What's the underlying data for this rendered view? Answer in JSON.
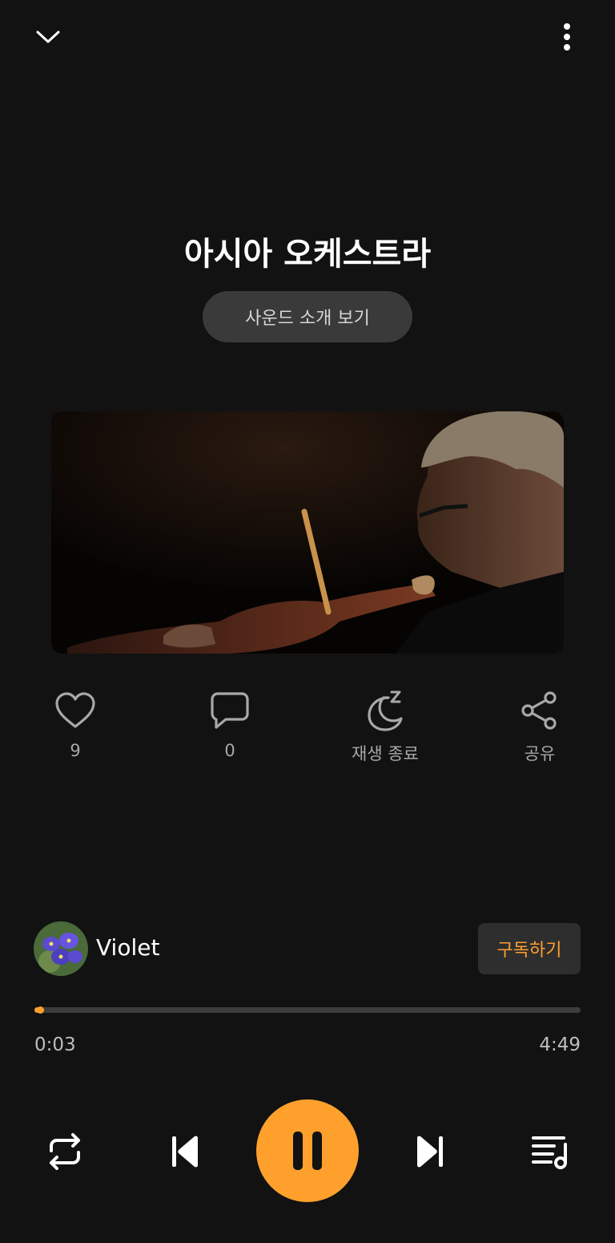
{
  "header": {
    "collapse_icon": "chevron-down-icon",
    "more_icon": "more-vertical-icon"
  },
  "track": {
    "title": "아시아 오케스트라",
    "intro_button_label": "사운드 소개 보기",
    "cover_description": "violinist"
  },
  "actions": [
    {
      "icon": "heart-icon",
      "label": "9"
    },
    {
      "icon": "comment-icon",
      "label": "0"
    },
    {
      "icon": "sleep-timer-icon",
      "label": "재생 종료"
    },
    {
      "icon": "share-icon",
      "label": "공유"
    }
  ],
  "artist": {
    "name": "Violet",
    "subscribe_label": "구독하기"
  },
  "playback": {
    "current_time": "0:03",
    "total_time": "4:49",
    "progress_fraction": 0.0104
  },
  "controls": {
    "repeat_icon": "repeat-icon",
    "previous_icon": "skip-previous-icon",
    "pause_icon": "pause-icon",
    "next_icon": "skip-next-icon",
    "playlist_icon": "playlist-icon"
  },
  "colors": {
    "background": "#121212",
    "accent": "#ffa02d",
    "button_bg": "#3a3a3a"
  }
}
